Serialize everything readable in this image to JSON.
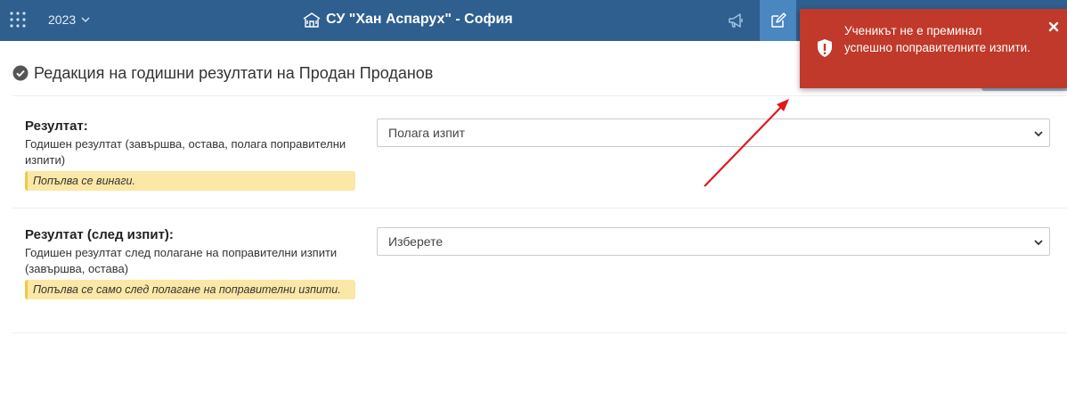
{
  "header": {
    "year": "2023",
    "school_title": "СУ \"Хан Аспарух\" - София"
  },
  "page": {
    "title": "Редакция на годишни резултати на Продан Проданов"
  },
  "form": {
    "rows": [
      {
        "label": "Резултат:",
        "description": "Годишен резултат (завършва, остава, полага поправителни изпити)",
        "hint": "Попълва се винаги.",
        "select_value": "Полага изпит"
      },
      {
        "label": "Резултат (след изпит):",
        "description": "Годишен резултат след полагане на поправителни изпити (завършва, остава)",
        "hint": "Попълва се само след полагане на поправителни изпити.",
        "select_value": "Изберете"
      }
    ]
  },
  "toast": {
    "type": "error",
    "message": "Ученикът не е преминал успешно поправителните изпити.",
    "icon": "shield-exclamation-icon"
  },
  "icons": {
    "apps": "apps-grid-icon",
    "year_chevron": "chevron-down-icon",
    "school": "school-building-icon",
    "announce": "megaphone-icon",
    "edit": "edit-icon",
    "title_check": "check-circle-icon",
    "close": "close-icon"
  },
  "colors": {
    "header_bg": "#2e5f8f",
    "active_nav": "#4a86c0",
    "toast_bg": "#c0392b",
    "hint_bg": "#fbe8a6",
    "hint_border": "#f0c940",
    "annotation_arrow": "#e0191b"
  }
}
